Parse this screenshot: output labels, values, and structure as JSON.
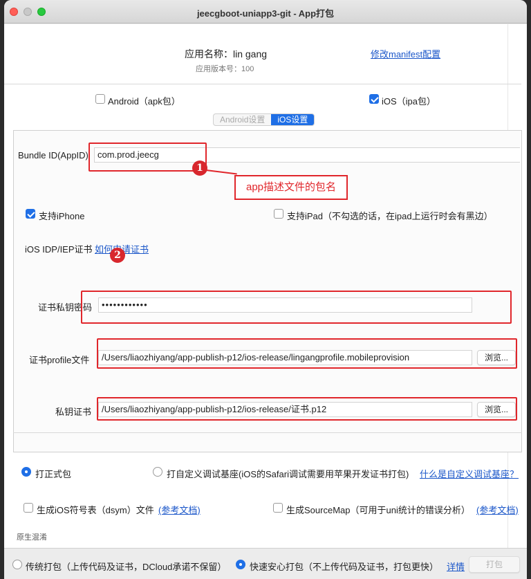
{
  "window": {
    "title": "jeecgboot-uniapp3-git - App打包"
  },
  "header": {
    "app_name_label": "应用名称：lin gang",
    "app_version_label": "应用版本号：100",
    "edit_manifest_link": "修改manifest配置"
  },
  "platforms": {
    "android_label": "Android（apk包）",
    "android_checked": false,
    "ios_label": "iOS（ipa包）",
    "ios_checked": true
  },
  "tabs": [
    {
      "label": "Android设置",
      "active": false
    },
    {
      "label": "iOS设置",
      "active": true
    }
  ],
  "ios_settings": {
    "bundle_id_label": "Bundle ID(AppID)",
    "bundle_id_value": "com.prod.jeecg",
    "support_iphone_label": "支持iPhone",
    "support_iphone_checked": true,
    "support_ipad_label": "支持iPad（不勾选的话，在ipad上运行时会有黑边）",
    "support_ipad_checked": false,
    "cert_type_label": "iOS IDP/IEP证书",
    "how_to_apply_link": "如何申请证书",
    "cert_password_label": "证书私钥密码",
    "cert_password_value": "••••••••••••",
    "profile_label": "证书profile文件",
    "profile_value": "/Users/liaozhiyang/app-publish-p12/ios-release/lingangprofile.mobileprovision",
    "browse_label_1": "浏览...",
    "private_cert_label": "私钥证书",
    "private_cert_value": "/Users/liaozhiyang/app-publish-p12/ios-release/证书.p12",
    "browse_label_2": "浏览..."
  },
  "annotations": {
    "badge_1": "1",
    "badge_2": "2",
    "callout_text": "app描述文件的包名",
    "annotation_color": "#e0262b"
  },
  "package_type": {
    "formal_label": "打正式包",
    "formal_checked": true,
    "custom_base_label": "打自定义调试基座(iOS的Safari调试需要用苹果开发证书打包)",
    "custom_base_checked": false,
    "custom_base_link": "什么是自定义调试基座？"
  },
  "options": {
    "dsym_label": "生成iOS符号表（dsym）文件",
    "dsym_checked": false,
    "dsym_link": "(参考文档)",
    "sourcemap_label": "生成SourceMap（可用于uni统计的错误分析）",
    "sourcemap_checked": false,
    "sourcemap_link": "(参考文档)",
    "native_section_label": "原生混淆"
  },
  "footer": {
    "traditional_label": "传统打包（上传代码及证书，DCloud承诺不保留）",
    "traditional_checked": false,
    "fast_label": "快速安心打包（不上传代码及证书，打包更快）",
    "fast_checked": true,
    "details_link": "详情",
    "build_button": "打包"
  },
  "colors": {
    "accent": "#1f6fe6",
    "link": "#1a56c9"
  }
}
